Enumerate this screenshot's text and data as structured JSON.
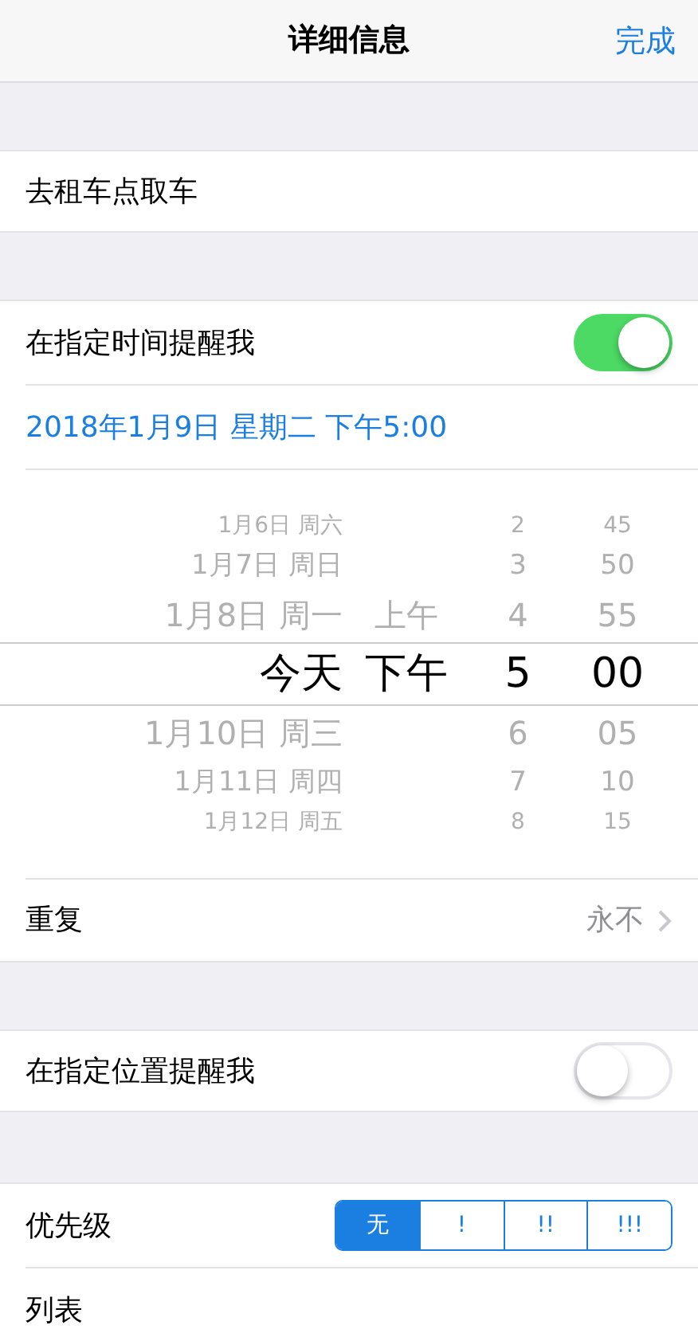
{
  "nav": {
    "title": "详细信息",
    "done": "完成"
  },
  "title_row": {
    "text": "去租车点取车"
  },
  "time_alarm": {
    "label": "在指定时间提醒我",
    "on": true,
    "date": "2018年1月9日 星期二 下午5:00"
  },
  "picker": {
    "columns": [
      {
        "kind": "date",
        "items": [
          {
            "text": "1月6日 周六",
            "selected": false
          },
          {
            "text": "1月7日 周日",
            "selected": false
          },
          {
            "text": "1月8日 周一",
            "selected": false
          },
          {
            "text": "今天",
            "selected": true
          },
          {
            "text": "1月10日 周三",
            "selected": false
          },
          {
            "text": "1月11日 周四",
            "selected": false
          },
          {
            "text": "1月12日 周五",
            "selected": false
          }
        ]
      },
      {
        "kind": "ampm",
        "items": [
          {
            "text": "上午",
            "selected": false
          },
          {
            "text": "下午",
            "selected": true
          }
        ]
      },
      {
        "kind": "hour",
        "items": [
          {
            "text": "2",
            "selected": false
          },
          {
            "text": "3",
            "selected": false
          },
          {
            "text": "4",
            "selected": false
          },
          {
            "text": "5",
            "selected": true
          },
          {
            "text": "6",
            "selected": false
          },
          {
            "text": "7",
            "selected": false
          },
          {
            "text": "8",
            "selected": false
          }
        ]
      },
      {
        "kind": "minute",
        "items": [
          {
            "text": "45",
            "selected": false
          },
          {
            "text": "50",
            "selected": false
          },
          {
            "text": "55",
            "selected": false
          },
          {
            "text": "00",
            "selected": true
          },
          {
            "text": "05",
            "selected": false
          },
          {
            "text": "10",
            "selected": false
          },
          {
            "text": "15",
            "selected": false
          }
        ]
      }
    ]
  },
  "repeat": {
    "label": "重复",
    "value": "永不"
  },
  "location_alarm": {
    "label": "在指定位置提醒我",
    "on": false
  },
  "priority": {
    "label": "优先级",
    "options": [
      {
        "text": "无",
        "selected": true
      },
      {
        "text": "!",
        "selected": false
      },
      {
        "text": "!!",
        "selected": false
      },
      {
        "text": "!!!",
        "selected": false
      }
    ]
  },
  "list": {
    "label": "列表"
  }
}
